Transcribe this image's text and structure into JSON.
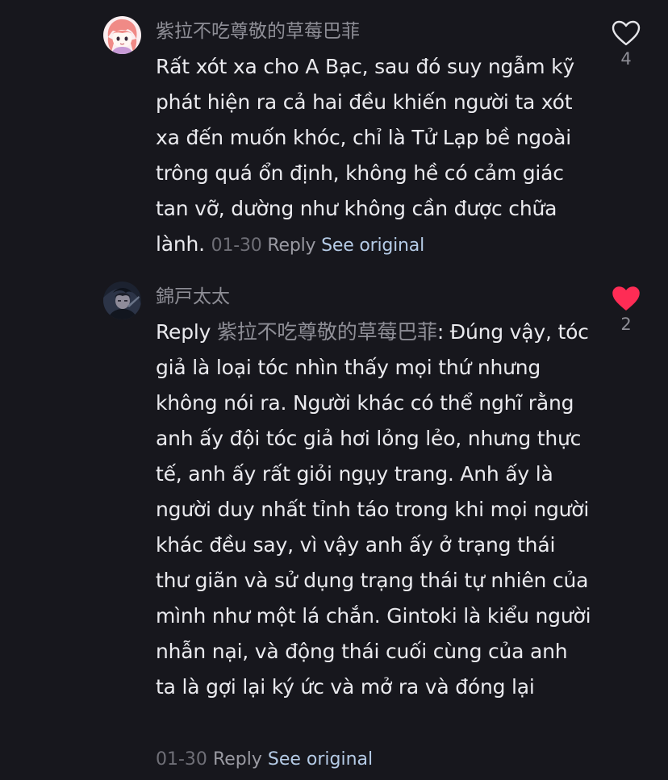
{
  "comments": [
    {
      "username": "紫拉不吃尊敬的草莓巴菲",
      "text": "Rất xót xa cho A Bạc, sau đó suy ngẫm kỹ phát hiện ra cả hai đều khiến người ta xót xa đến muốn khóc, chỉ là Tử Lạp bề ngoài trông quá ổn định, không hề có cảm giác tan vỡ, dường như không cần được chữa lành.",
      "date": "01-30",
      "reply_label": "Reply",
      "see_original_label": "See original",
      "like_count": "4",
      "liked": false,
      "avatar_icon": "anime-girl-avatar"
    },
    {
      "username": "錦戸太太",
      "reply_prefix": "Reply",
      "reply_target": "紫拉不吃尊敬的草莓巴菲",
      "text": ": Đúng vậy, tóc giả là loại tóc nhìn thấy mọi thứ nhưng không nói ra. Người khác có thể nghĩ rằng anh ấy đội tóc giả hơi lỏng lẻo, nhưng thực tế, anh ấy rất giỏi ngụy trang. Anh ấy là người duy nhất tỉnh táo trong khi mọi người khác đều say, vì vậy anh ấy ở trạng thái thư giãn và sử dụng trạng thái tự nhiên của mình như một lá chắn. Gintoki là kiểu người nhẫn nại, và động thái cuối cùng của anh ta là gợi lại ký ức và mở ra và đóng lại",
      "date": "01-30",
      "reply_label": "Reply",
      "see_original_label": "See original",
      "like_count": "2",
      "liked": true,
      "avatar_icon": "dark-character-avatar"
    }
  ],
  "colors": {
    "background": "#17171d",
    "text": "#eaeaee",
    "muted": "#8e8e96",
    "link": "#b5cbe6",
    "like_active": "#fe2c55"
  }
}
